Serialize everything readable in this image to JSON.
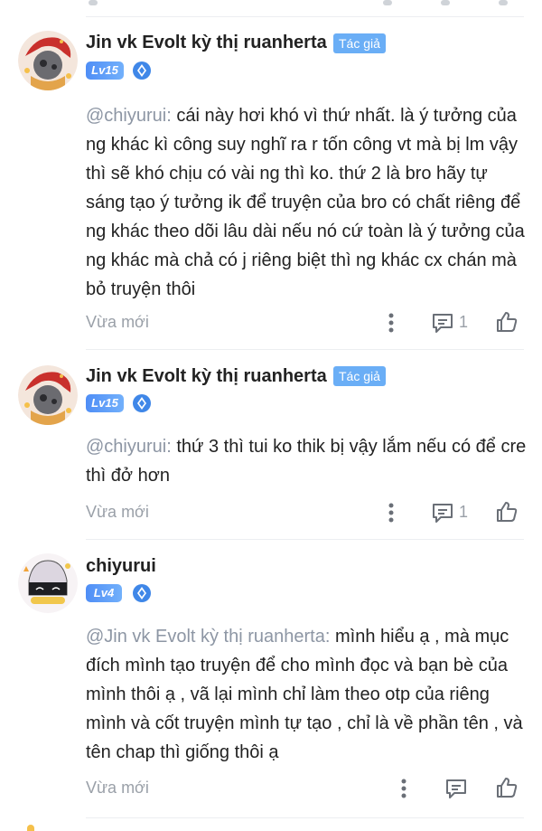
{
  "comments": [
    {
      "username": "Jin vk Evolt kỳ thị ruanherta",
      "author_badge": "Tác giả",
      "level": "Lv15",
      "mention": "@chiyurui:",
      "text": " cái này hơi khó vì thứ nhất. là ý tưởng của ng khác kì công suy nghĩ ra r tốn công vt mà bị lm vậy thì sẽ khó chịu có vài ng thì ko. thứ 2 là bro hãy tự sáng tạo ý tưởng ik để truyện của bro có chất riêng để ng khác theo dõi lâu dài nếu nó cứ toàn là ý tưởng của ng khác mà chả có j riêng biệt thì ng khác cx chán mà bỏ truyện thôi",
      "time": "Vừa mới",
      "reply_count": "1"
    },
    {
      "username": "Jin vk Evolt kỳ thị ruanherta",
      "author_badge": "Tác giả",
      "level": "Lv15",
      "mention": "@chiyurui:",
      "text": " thứ 3 thì tui ko thik bị vậy lắm nếu có để cre thì đở hơn",
      "time": "Vừa mới",
      "reply_count": "1"
    },
    {
      "username": "chiyurui",
      "level": "Lv4",
      "mention": "@Jin vk Evolt kỳ thị ruanherta:",
      "text": " mình hiểu ạ , mà mục đích mình tạo truyện để cho mình đọc và bạn bè của mình thôi ạ , vã lại mình chỉ làm theo otp của riêng mình và cốt truyện mình tự tạo , chỉ là về phần tên , và tên chap thì giống thôi ạ",
      "time": "Vừa mới"
    }
  ],
  "colors": {
    "author_badge": "#6aaef6",
    "level_badge": "#4f8ef6",
    "mention": "#8d96a4",
    "meta": "#9aa0a8"
  },
  "icons": [
    "more-vertical-icon",
    "reply-comment-icon",
    "thumbs-up-icon",
    "verified-icon"
  ]
}
